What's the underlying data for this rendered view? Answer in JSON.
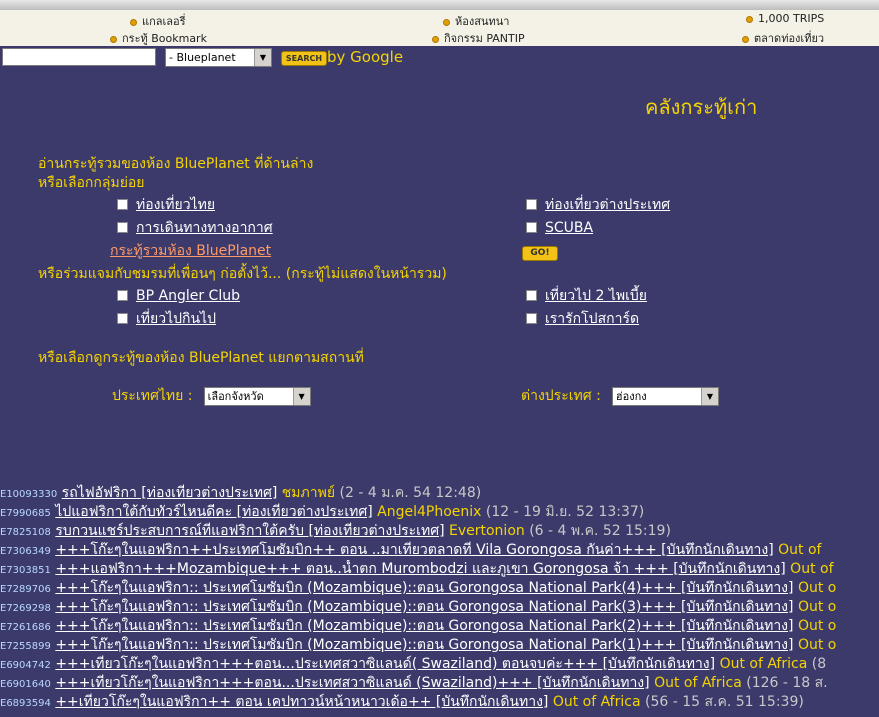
{
  "nav": {
    "gallery": "แกลเลอรี่",
    "chatroom": "ห้องสนทนา",
    "trips": "1,000 TRIPS",
    "bookmark": "กระทู้ Bookmark",
    "activities": "กิจกรรม PANTIP",
    "market": "ตลาดท่องเที่ยว"
  },
  "search": {
    "value": "",
    "room": "- Blueplanet",
    "button": "SEARCH",
    "by": "by Google"
  },
  "page_title": "คลังกระทู้เก่า",
  "intro_line1": "อ่านกระทู้รวมของห้อง BluePlanet ที่ด้านล่าง",
  "intro_line2": "หรือเลือกกลุ่มย่อย",
  "groups": {
    "thai_travel": "ท่องเที่ยวไทย",
    "intl_travel": "ท่องเที่ยวต่างประเทศ",
    "air_travel": "การเดินทางทางอากาศ",
    "scuba": "SCUBA",
    "all_link": "กระทู้รวมห้อง BluePlanet",
    "go": "GO!"
  },
  "clubs_heading": "หรือร่วมแจมกับชมรมที่เพื่อนๆ ก่อตั้งไว้... (กระทู้ไม่แสดงในหน้ารวม)",
  "clubs": {
    "angler": "BP Angler Club",
    "backpack": "เที่ยวไป 2 ไพเบี้ย",
    "eat": "เที่ยวไปกินไป",
    "postcard": "เรารักโปสการ์ด"
  },
  "place_heading": "หรือเลือกดูกระทู้ของห้อง BluePlanet แยกตามสถานที่",
  "place": {
    "thai_label": "ประเทศไทย :",
    "thai_value": "เลือกจังหวัด",
    "intl_label": "ต่างประเทศ :",
    "intl_value": "ฮ่องกง"
  },
  "threads": [
    {
      "id": "E10093330",
      "title": "รถไฟอัฟริกา [ท่องเที่ยวต่างประเทศ]",
      "author": "ชมภาพย์",
      "date": "(2 - 4 ม.ค. 54 12:48)"
    },
    {
      "id": "E7990685",
      "title": "ไปแอฟริกาใต้กับทัวร์ไหนดีคะ [ท่องเที่ยวต่างประเทศ]",
      "author": "Angel4Phoenix",
      "date": "(12 - 19 มิ.ย. 52 13:37)"
    },
    {
      "id": "E7825108",
      "title": "รบกวนแชร์ประสบการณ์ที่แอฟริกาใต้ครับ [ท่องเที่ยวต่างประเทศ]",
      "author": "Evertonion",
      "date": "(6 - 4 พ.ค. 52 15:19)"
    },
    {
      "id": "E7306349",
      "title": "+++โก๊ะๆในแอฟริกา++ประเทศโมซัมบิก++ ตอน ..มาเที่ยวตลาดที่ Vila Gorongosa กันค่า+++ [บันทึกนักเดินทาง]",
      "author": "Out of",
      "date": ""
    },
    {
      "id": "E7303851",
      "title": "+++แอฟริกา+++Mozambique+++ ตอน..น้ำตก Murombodzi และภูเขา Gorongosa จ้า +++ [บันทึกนักเดินทาง]",
      "author": "Out of",
      "date": ""
    },
    {
      "id": "E7289706",
      "title": "+++โก๊ะๆในแอฟริกา:: ประเทศโมซัมบิก (Mozambique)::ตอน Gorongosa National Park(4)+++ [บันทึกนักเดินทาง]",
      "author": "Out o",
      "date": ""
    },
    {
      "id": "E7269298",
      "title": "+++โก๊ะๆในแอฟริกา:: ประเทศโมซัมบิก (Mozambique)::ตอน Gorongosa National Park(3)+++ [บันทึกนักเดินทาง]",
      "author": "Out o",
      "date": ""
    },
    {
      "id": "E7261686",
      "title": "+++โก๊ะๆในแอฟริกา:: ประเทศโมซัมบิก (Mozambique)::ตอน Gorongosa National Park(2)+++ [บันทึกนักเดินทาง]",
      "author": "Out o",
      "date": ""
    },
    {
      "id": "E7255899",
      "title": "+++โก๊ะๆในแอฟริกา:: ประเทศโมซัมบิก (Mozambique)::ตอน Gorongosa National Park(1)+++ [บันทึกนักเดินทาง]",
      "author": "Out o",
      "date": ""
    },
    {
      "id": "E6904742",
      "title": "+++เที่ยวโก๊ะๆในแอฟริกา+++ตอน...ประเทศสวาซิแลนด์( Swaziland) ตอนจบค่ะ+++ [บันทึกนักเดินทาง]",
      "author": "Out of Africa",
      "date": "(8"
    },
    {
      "id": "E6901640",
      "title": "+++เที่ยวโก๊ะๆในแอฟริกา+++ตอน...ประเทศสวาซิแลนด์ (Swaziland)+++ [บันทึกนักเดินทาง]",
      "author": "Out of Africa",
      "date": "(126 - 18 ส."
    },
    {
      "id": "E6893594",
      "title": "++เที่ยวโก๊ะๆในแอฟริกา++ ตอน เคปทาวน์หน้าหนาวเด้อ++ [บันทึกนักเดินทาง]",
      "author": "Out of Africa",
      "date": "(56 - 15 ส.ค. 51 15:39)"
    }
  ]
}
